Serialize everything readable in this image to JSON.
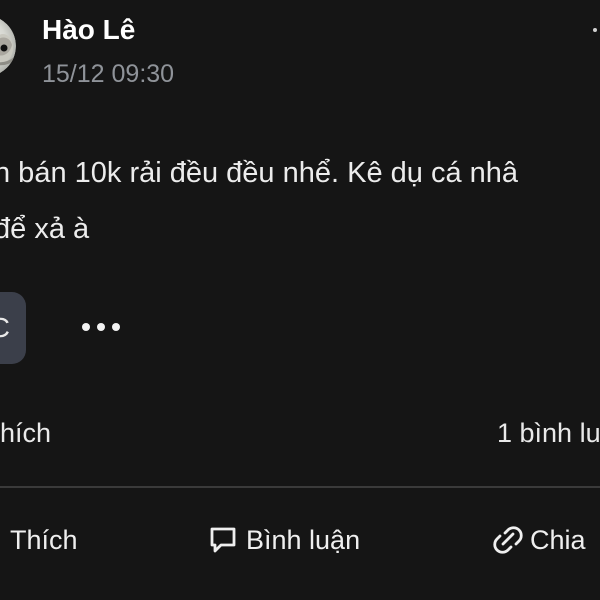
{
  "post": {
    "author": "Hào Lê",
    "time": "15/12 09:30",
    "text_lines": [
      "n bán 10k rải đều đều nhể. Kê dụ cá nhâ",
      "để xả à"
    ]
  },
  "reaction_chip": {
    "text": "C"
  },
  "stats": {
    "likes": "hích",
    "comments": "1 bình lu"
  },
  "actions": {
    "like": "Thích",
    "comment": "Bình luận",
    "share": "Chia"
  },
  "icons": {
    "avatar": "avatar-image",
    "post_more": "more-vertical-icon",
    "more": "more-horizontal-icon",
    "comment": "comment-icon",
    "share": "share-link-icon"
  },
  "colors": {
    "background": "#151515",
    "text": "#f1f1f1",
    "secondary": "#8f9399",
    "chip": "#3b3f4a",
    "divider": "#3a3a3a"
  }
}
